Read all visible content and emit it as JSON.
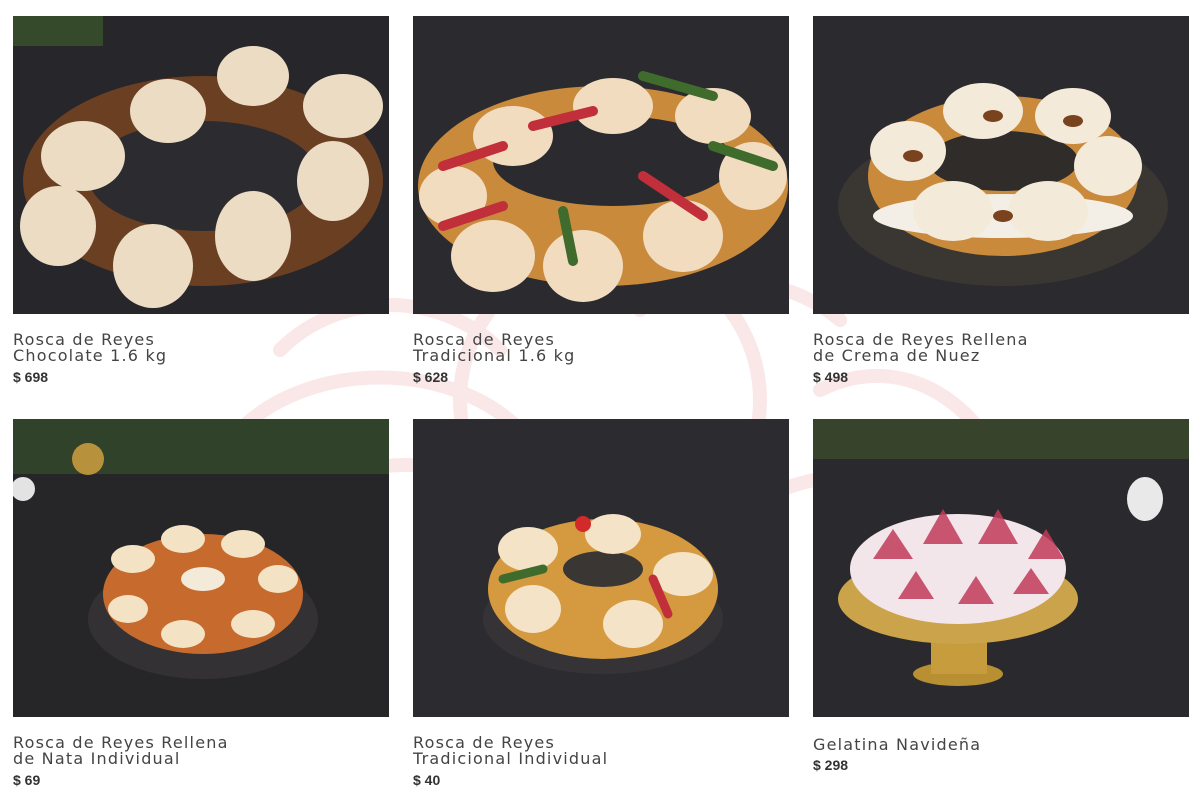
{
  "accent_color": "#f4c7c9",
  "products": [
    {
      "name": "Rosca de Reyes\nChocolate 1.6 kg",
      "price": "$ 698",
      "image": "rosca-chocolate-image"
    },
    {
      "name": "Rosca de Reyes\nTradicional 1.6 kg",
      "price": "$ 628",
      "image": "rosca-tradicional-image"
    },
    {
      "name": "Rosca de Reyes Rellena\nde Crema de Nuez",
      "price": "$ 498",
      "image": "rosca-nuez-image"
    },
    {
      "name": "Rosca de Reyes Rellena\nde Nata Individual",
      "price": "$ 69",
      "image": "rosca-nata-individual-image"
    },
    {
      "name": "Rosca de Reyes\nTradicional Individual",
      "price": "$ 40",
      "image": "rosca-tradicional-individual-image"
    },
    {
      "name": "Gelatina Navideña",
      "price": "$ 298",
      "image": "gelatina-image"
    }
  ]
}
